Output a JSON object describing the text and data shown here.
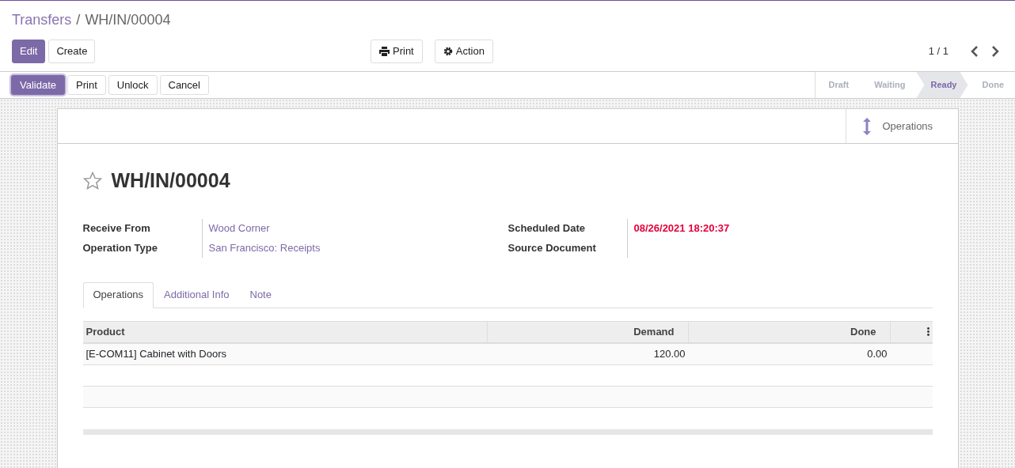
{
  "breadcrumb": [
    {
      "label": "Transfers",
      "kind": "link"
    },
    {
      "label": "WH/IN/00004",
      "kind": "current"
    }
  ],
  "separator": "/",
  "main_buttons": [
    {
      "label": "Edit",
      "primary": true
    },
    {
      "label": "Create",
      "primary": false
    }
  ],
  "center_buttons": [
    {
      "label": "Print"
    },
    {
      "label": "Action"
    }
  ],
  "pager": "1 / 1",
  "state_buttons": [
    {
      "label": "Validate",
      "primary": true
    },
    {
      "label": "Print",
      "primary": false
    },
    {
      "label": "Unlock",
      "primary": false
    },
    {
      "label": "Cancel",
      "primary": false
    }
  ],
  "statusbar": [
    {
      "label": "Draft",
      "selected": false
    },
    {
      "label": "Waiting",
      "selected": false
    },
    {
      "label": "Ready",
      "selected": true
    },
    {
      "label": "Done",
      "selected": false
    }
  ],
  "smart_button": {
    "label": "Operations"
  },
  "title": "WH/IN/00004",
  "starred": false,
  "fields_left": [
    {
      "label": "Receive From",
      "value": "Wood Corner",
      "kind": "link"
    },
    {
      "label": "Operation Type",
      "value": "San Francisco: Receipts",
      "kind": "link"
    }
  ],
  "fields_right": [
    {
      "label": "Scheduled Date",
      "value": "08/26/2021 18:20:37",
      "kind": "date"
    },
    {
      "label": "Source Document",
      "kind": "empty"
    }
  ],
  "tabs": [
    {
      "label": "Operations",
      "selected": true
    },
    {
      "label": "Additional Info",
      "selected": false
    },
    {
      "label": "Note",
      "selected": false
    }
  ],
  "table": {
    "columns": [
      {
        "label": "Product"
      },
      {
        "label": "Demand"
      },
      {
        "label": "Done"
      }
    ],
    "rows": [
      [
        "[E-COM11] Cabinet with Doors",
        "120.00",
        "0.00"
      ]
    ]
  }
}
